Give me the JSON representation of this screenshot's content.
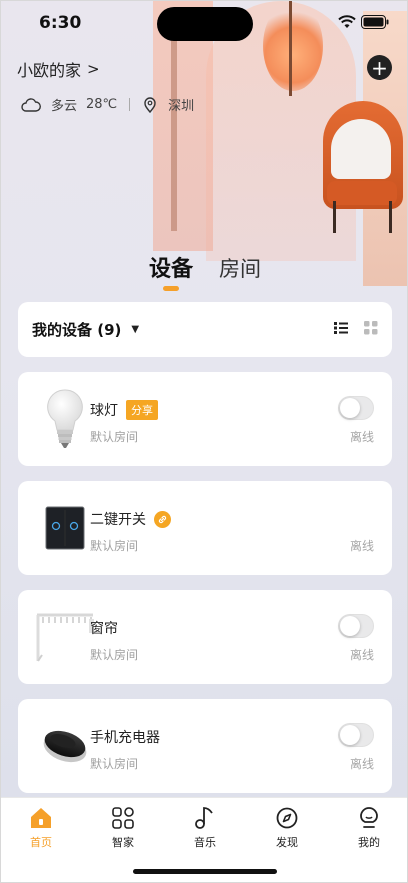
{
  "status_bar": {
    "time": "6:30"
  },
  "header": {
    "home_name": "小欧的家",
    "chevron": ">",
    "add_symbol": "+",
    "weather": "多云",
    "temperature": "28℃",
    "city": "深圳"
  },
  "tabs": [
    {
      "label": "设备",
      "active": true
    },
    {
      "label": "房间",
      "active": false
    }
  ],
  "device_header": {
    "label": "我的设备 (9)",
    "caret": "▼"
  },
  "devices": [
    {
      "name": "球灯",
      "badge": "分享",
      "room": "默认房间",
      "status": "离线",
      "icon": "bulb-icon",
      "has_toggle": true
    },
    {
      "name": "二键开关",
      "badge_icon": "link-icon",
      "room": "默认房间",
      "status": "离线",
      "icon": "wall-switch-icon",
      "has_toggle": false
    },
    {
      "name": "窗帘",
      "room": "默认房间",
      "status": "离线",
      "icon": "curtain-rail-icon",
      "has_toggle": true
    },
    {
      "name": "手机充电器",
      "room": "默认房间",
      "status": "离线",
      "icon": "wireless-charger-icon",
      "has_toggle": true
    }
  ],
  "bottom_nav": [
    {
      "label": "首页",
      "icon": "home-icon",
      "active": true
    },
    {
      "label": "智家",
      "icon": "grid-icon",
      "active": false
    },
    {
      "label": "音乐",
      "icon": "music-note-icon",
      "active": false
    },
    {
      "label": "发现",
      "icon": "compass-icon",
      "active": false
    },
    {
      "label": "我的",
      "icon": "profile-icon",
      "active": false
    }
  ],
  "colors": {
    "accent": "#f5a02a",
    "badge": "#f5a623",
    "background": "#e6e6ef",
    "card": "#ffffff"
  }
}
